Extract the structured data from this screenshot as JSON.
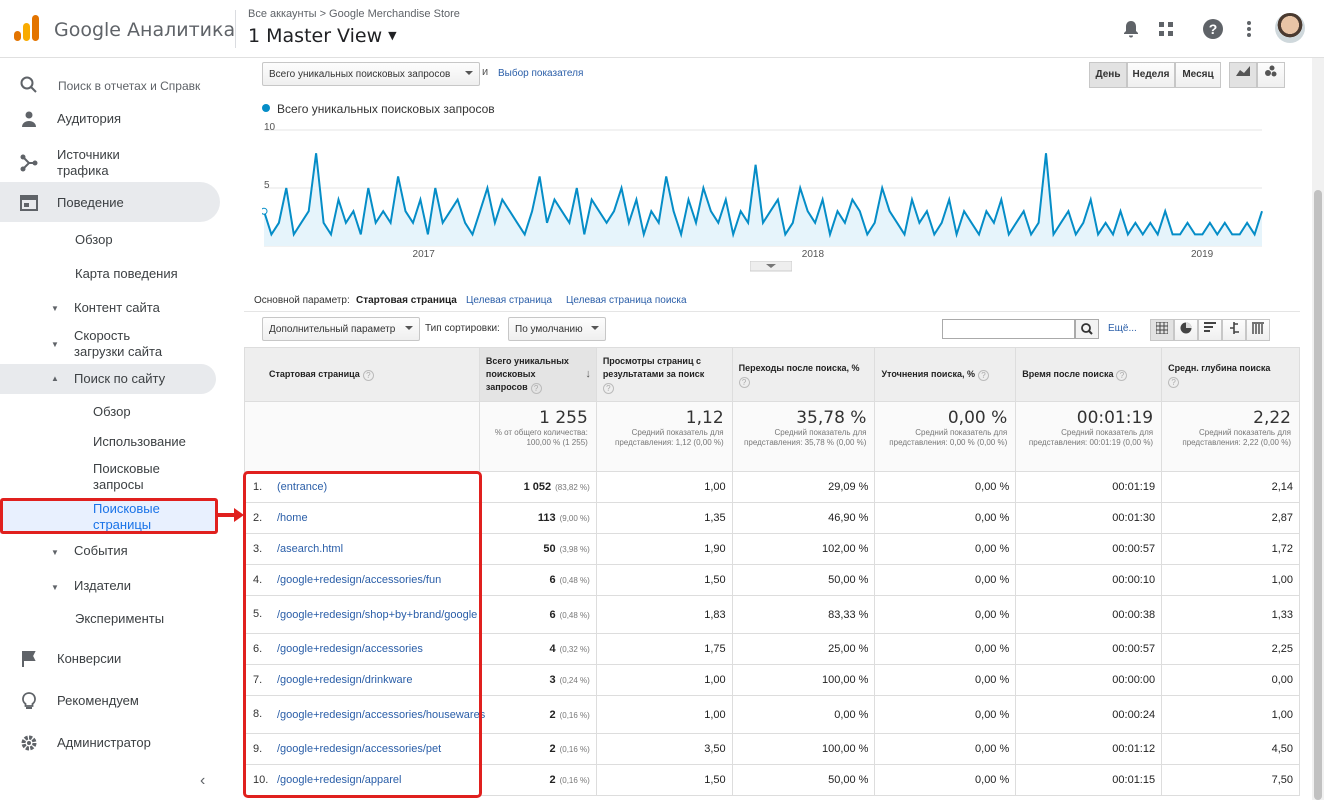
{
  "app": {
    "name": "Google Аналитика",
    "breadcrumb": "Все аккаунты > Google Merchandise Store",
    "view": "1 Master View"
  },
  "sidebar": {
    "search": "Поиск в отчетах и Справк",
    "audience": "Аудитория",
    "acquisition": "Источники трафика",
    "behavior": "Поведение",
    "overview": "Обзор",
    "flow": "Карта поведения",
    "content": "Контент сайта",
    "speed": "Скорость загрузки сайта",
    "site_search": "Поиск по сайту",
    "ss_overview": "Обзор",
    "ss_usage": "Использование",
    "ss_terms": "Поисковые запросы",
    "ss_pages": "Поисковые страницы",
    "events": "События",
    "publisher": "Издатели",
    "experiments": "Эксперименты",
    "conversions": "Конверсии",
    "recommend": "Рекомендуем",
    "admin": "Администратор"
  },
  "controls": {
    "metric_select": "Всего уникальных поисковых запросов",
    "and": "и",
    "choose_metric": "Выбор показателя",
    "day": "День",
    "week": "Неделя",
    "month": "Месяц"
  },
  "chart_data": {
    "type": "line",
    "series": [
      {
        "name": "Всего уникальных поисковых запросов",
        "values": [
          3,
          1,
          2,
          5,
          1,
          2,
          3,
          8,
          2,
          1,
          4,
          2,
          3,
          1,
          5,
          2,
          3,
          2,
          6,
          3,
          2,
          4,
          1,
          5,
          2,
          3,
          4,
          2,
          1,
          3,
          5,
          2,
          4,
          3,
          2,
          1,
          3,
          6,
          2,
          4,
          3,
          2,
          5,
          1,
          4,
          3,
          2,
          3,
          5,
          2,
          4,
          1,
          3,
          2,
          6,
          3,
          1,
          4,
          2,
          5,
          3,
          2,
          4,
          1,
          3,
          2,
          7,
          2,
          3,
          4,
          1,
          2,
          5,
          3,
          2,
          4,
          1,
          3,
          2,
          4,
          3,
          1,
          2,
          5,
          3,
          2,
          1,
          4,
          2,
          3,
          1,
          2,
          4,
          1,
          3,
          2,
          1,
          3,
          2,
          4,
          1,
          2,
          3,
          1,
          2,
          8,
          1,
          2,
          3,
          1,
          2,
          4,
          1,
          2,
          1,
          3,
          1,
          2,
          1,
          2,
          1,
          3,
          1,
          1,
          2,
          1,
          1,
          2,
          1,
          2,
          1,
          1,
          2,
          1,
          3
        ]
      }
    ],
    "x_ticks": [
      "2017",
      "2018",
      "2019"
    ],
    "y_ticks": [
      "10",
      "5"
    ],
    "ylim": [
      0,
      10
    ]
  },
  "params": {
    "primary_label": "Основной параметр:",
    "active": "Стартовая страница",
    "opt1": "Целевая страница",
    "opt2": "Целевая страница поиска",
    "secondary": "Дополнительный параметр",
    "sort_label": "Тип сортировки:",
    "sort_value": "По умолчанию",
    "more": "Ещё..."
  },
  "table": {
    "headers": [
      "Стартовая страница",
      "Всего уникальных поисковых запросов",
      "Просмотры страниц с результатами за поиск",
      "Переходы после поиска, %",
      "Уточнения поиска, %",
      "Время после поиска",
      "Средн. глубина поиска"
    ],
    "totals": [
      {
        "big": "1 255",
        "small": "% от общего количества: 100,00 % (1 255)"
      },
      {
        "big": "1,12",
        "small": "Средний показатель для представления: 1,12 (0,00 %)"
      },
      {
        "big": "35,78 %",
        "small": "Средний показатель для представления: 35,78 % (0,00 %)"
      },
      {
        "big": "0,00 %",
        "small": "Средний показатель для представления: 0,00 % (0,00 %)"
      },
      {
        "big": "00:01:19",
        "small": "Средний показатель для представления: 00:01:19 (0,00 %)"
      },
      {
        "big": "2,22",
        "small": "Средний показатель для представления: 2,22 (0,00 %)"
      }
    ],
    "rows": [
      {
        "n": "1.",
        "page": "(entrance)",
        "q": "1 052",
        "qp": "(83,82 %)",
        "v": "1,00",
        "e": "29,09 %",
        "r": "0,00 %",
        "t": "00:01:19",
        "d": "2,14"
      },
      {
        "n": "2.",
        "page": "/home",
        "q": "113",
        "qp": "(9,00 %)",
        "v": "1,35",
        "e": "46,90 %",
        "r": "0,00 %",
        "t": "00:01:30",
        "d": "2,87"
      },
      {
        "n": "3.",
        "page": "/asearch.html",
        "q": "50",
        "qp": "(3,98 %)",
        "v": "1,90",
        "e": "102,00 %",
        "r": "0,00 %",
        "t": "00:00:57",
        "d": "1,72"
      },
      {
        "n": "4.",
        "page": "/google+redesign/accessories/fun",
        "q": "6",
        "qp": "(0,48 %)",
        "v": "1,50",
        "e": "50,00 %",
        "r": "0,00 %",
        "t": "00:00:10",
        "d": "1,00"
      },
      {
        "n": "5.",
        "page": "/google+redesign/shop+by+brand/google",
        "q": "6",
        "qp": "(0,48 %)",
        "v": "1,83",
        "e": "83,33 %",
        "r": "0,00 %",
        "t": "00:00:38",
        "d": "1,33"
      },
      {
        "n": "6.",
        "page": "/google+redesign/accessories",
        "q": "4",
        "qp": "(0,32 %)",
        "v": "1,75",
        "e": "25,00 %",
        "r": "0,00 %",
        "t": "00:00:57",
        "d": "2,25"
      },
      {
        "n": "7.",
        "page": "/google+redesign/drinkware",
        "q": "3",
        "qp": "(0,24 %)",
        "v": "1,00",
        "e": "100,00 %",
        "r": "0,00 %",
        "t": "00:00:00",
        "d": "0,00"
      },
      {
        "n": "8.",
        "page": "/google+redesign/accessories/housewares",
        "q": "2",
        "qp": "(0,16 %)",
        "v": "1,00",
        "e": "0,00 %",
        "r": "0,00 %",
        "t": "00:00:24",
        "d": "1,00"
      },
      {
        "n": "9.",
        "page": "/google+redesign/accessories/pet",
        "q": "2",
        "qp": "(0,16 %)",
        "v": "3,50",
        "e": "100,00 %",
        "r": "0,00 %",
        "t": "00:01:12",
        "d": "4,50"
      },
      {
        "n": "10.",
        "page": "/google+redesign/apparel",
        "q": "2",
        "qp": "(0,16 %)",
        "v": "1,50",
        "e": "50,00 %",
        "r": "0,00 %",
        "t": "00:01:15",
        "d": "7,50"
      }
    ]
  }
}
